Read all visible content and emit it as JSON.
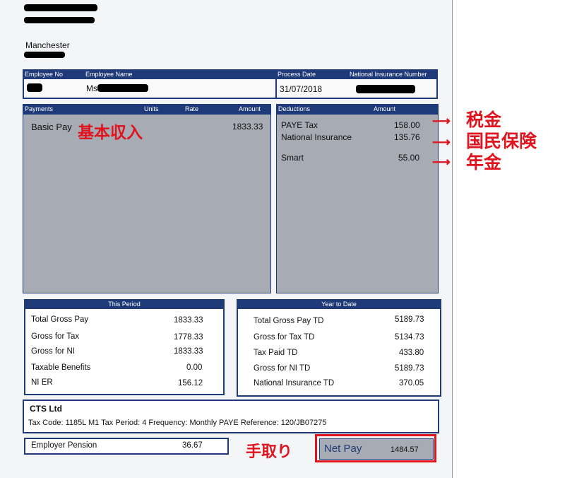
{
  "company_city": "Manchester",
  "header_fields": {
    "employee_no_label": "Employee No",
    "employee_name_label": "Employee Name",
    "process_date_label": "Process Date",
    "ni_number_label": "National Insurance Number",
    "employee_name_prefix": "Ms",
    "process_date": "31/07/2018"
  },
  "payments": {
    "title": "Payments",
    "units_label": "Units",
    "rate_label": "Rate",
    "amount_label": "Amount",
    "items": [
      {
        "label": "Basic Pay",
        "amount": "1833.33"
      }
    ]
  },
  "deductions": {
    "title": "Deductions",
    "amount_label": "Amount",
    "items": [
      {
        "label": "PAYE Tax",
        "amount": "158.00"
      },
      {
        "label": "National Insurance",
        "amount": "135.76"
      },
      {
        "label": "Smart",
        "amount": "55.00"
      }
    ]
  },
  "this_period": {
    "title": "This Period",
    "rows": [
      {
        "label": "Total Gross Pay",
        "value": "1833.33"
      },
      {
        "label": "Gross for Tax",
        "value": "1778.33"
      },
      {
        "label": "Gross for NI",
        "value": "1833.33"
      },
      {
        "label": "Taxable Benefits",
        "value": "0.00"
      },
      {
        "label": "NI ER",
        "value": "156.12"
      }
    ]
  },
  "year_to_date": {
    "title": "Year to Date",
    "rows": [
      {
        "label": "Total Gross Pay TD",
        "value": "5189.73"
      },
      {
        "label": "Gross for Tax TD",
        "value": "5134.73"
      },
      {
        "label": "Tax Paid TD",
        "value": "433.80"
      },
      {
        "label": "Gross for NI TD",
        "value": "5189.73"
      },
      {
        "label": "National Insurance TD",
        "value": "370.05"
      }
    ]
  },
  "employer": {
    "name": "CTS Ltd",
    "details": "Tax Code: 1185L M1  Tax Period: 4  Frequency: Monthly  PAYE Reference: 120/JB07275"
  },
  "employer_pension": {
    "label": "Employer Pension",
    "value": "36.67"
  },
  "net_pay": {
    "label": "Net Pay",
    "value": "1484.57"
  },
  "annotations": {
    "basic_income": "基本収入",
    "tax": "税金",
    "national_insurance": "国民保険",
    "pension": "年金",
    "take_home": "手取り",
    "accent_color": "#e0141e"
  }
}
